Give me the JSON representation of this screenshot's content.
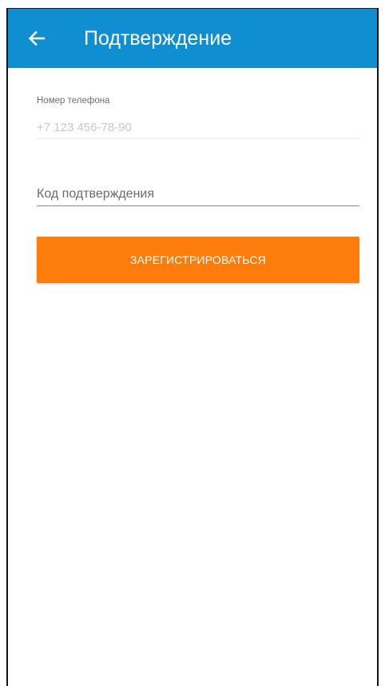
{
  "app_bar": {
    "title": "Подтверждение",
    "back_icon": "arrow-left-icon",
    "background_color": "#0f8fd1"
  },
  "phone_field": {
    "label": "Номер телефона",
    "placeholder": "+7 123 456-78-90",
    "value": ""
  },
  "code_field": {
    "placeholder": "Код подтверждения",
    "value": ""
  },
  "register_button": {
    "label": "ЗАРЕГИСТРИРОВАТЬСЯ",
    "color": "#fc7d0b"
  }
}
